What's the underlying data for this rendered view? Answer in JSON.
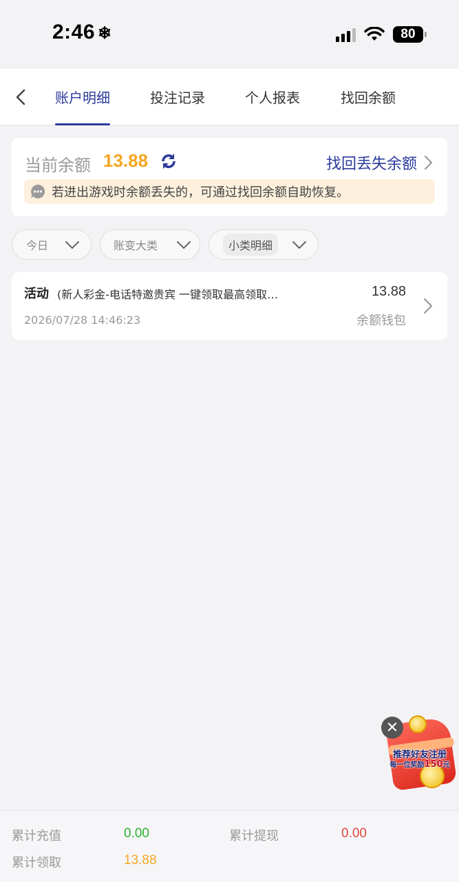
{
  "status_bar": {
    "time": "2:46",
    "snow_glyph": "❄",
    "battery": "80"
  },
  "tabs": [
    {
      "label": "账户明细",
      "active": true
    },
    {
      "label": "投注记录",
      "active": false
    },
    {
      "label": "个人报表",
      "active": false
    },
    {
      "label": "找回余额",
      "active": false
    }
  ],
  "balance": {
    "label": "当前余额",
    "value": "13.88",
    "recover_link": "找回丢失余额",
    "notice": "若进出游戏时余额丢失的，可通过找回余额自助恢复。"
  },
  "filters": [
    {
      "label": "今日"
    },
    {
      "label": "账变大类"
    },
    {
      "label": "小类明细"
    }
  ],
  "records": [
    {
      "type": "活动",
      "description": "(新人彩金-电话特邀贵宾 一键领取最高领取最高",
      "time": "2026/07/28 14:46:23",
      "amount": "13.88",
      "wallet": "余额钱包"
    }
  ],
  "promo": {
    "close_glyph": "✕",
    "title": "推荐好友注册",
    "sub_prefix": "每一位奖励",
    "sub_amount": "150",
    "sub_suffix": "元"
  },
  "summary": {
    "deposit_label": "累计充值",
    "deposit_value": "0.00",
    "withdraw_label": "累计提现",
    "withdraw_value": "0.00",
    "claim_label": "累计领取",
    "claim_value": "13.88"
  },
  "colors": {
    "accent": "#2b3a9c",
    "balance": "#f5a623",
    "deposit": "#2bb02b",
    "withdraw": "#e0473c",
    "claim": "#f5a623"
  }
}
